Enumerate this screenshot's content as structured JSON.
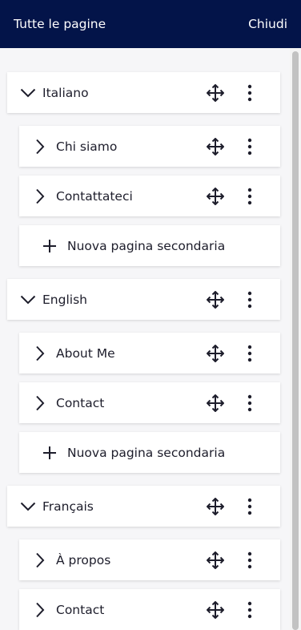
{
  "header": {
    "title": "Tutte le pagine",
    "close_label": "Chiudi"
  },
  "languages": [
    {
      "name": "Italiano",
      "pages": [
        "Chi siamo",
        "Contattateci"
      ],
      "add_label": "Nuova pagina secondaria"
    },
    {
      "name": "English",
      "pages": [
        "About Me",
        "Contact"
      ],
      "add_label": "Nuova pagina secondaria"
    },
    {
      "name": "Français",
      "pages": [
        "À propos",
        "Contact"
      ]
    }
  ],
  "icons": {
    "expanded": "chevron-down-icon",
    "collapsed": "chevron-right-icon",
    "move": "move-icon",
    "more": "more-vertical-icon",
    "add": "plus-icon"
  },
  "colors": {
    "header_bg": "#031449",
    "header_text": "#ffffff",
    "panel_bg": "#f6f6f8",
    "card_bg": "#ffffff"
  }
}
